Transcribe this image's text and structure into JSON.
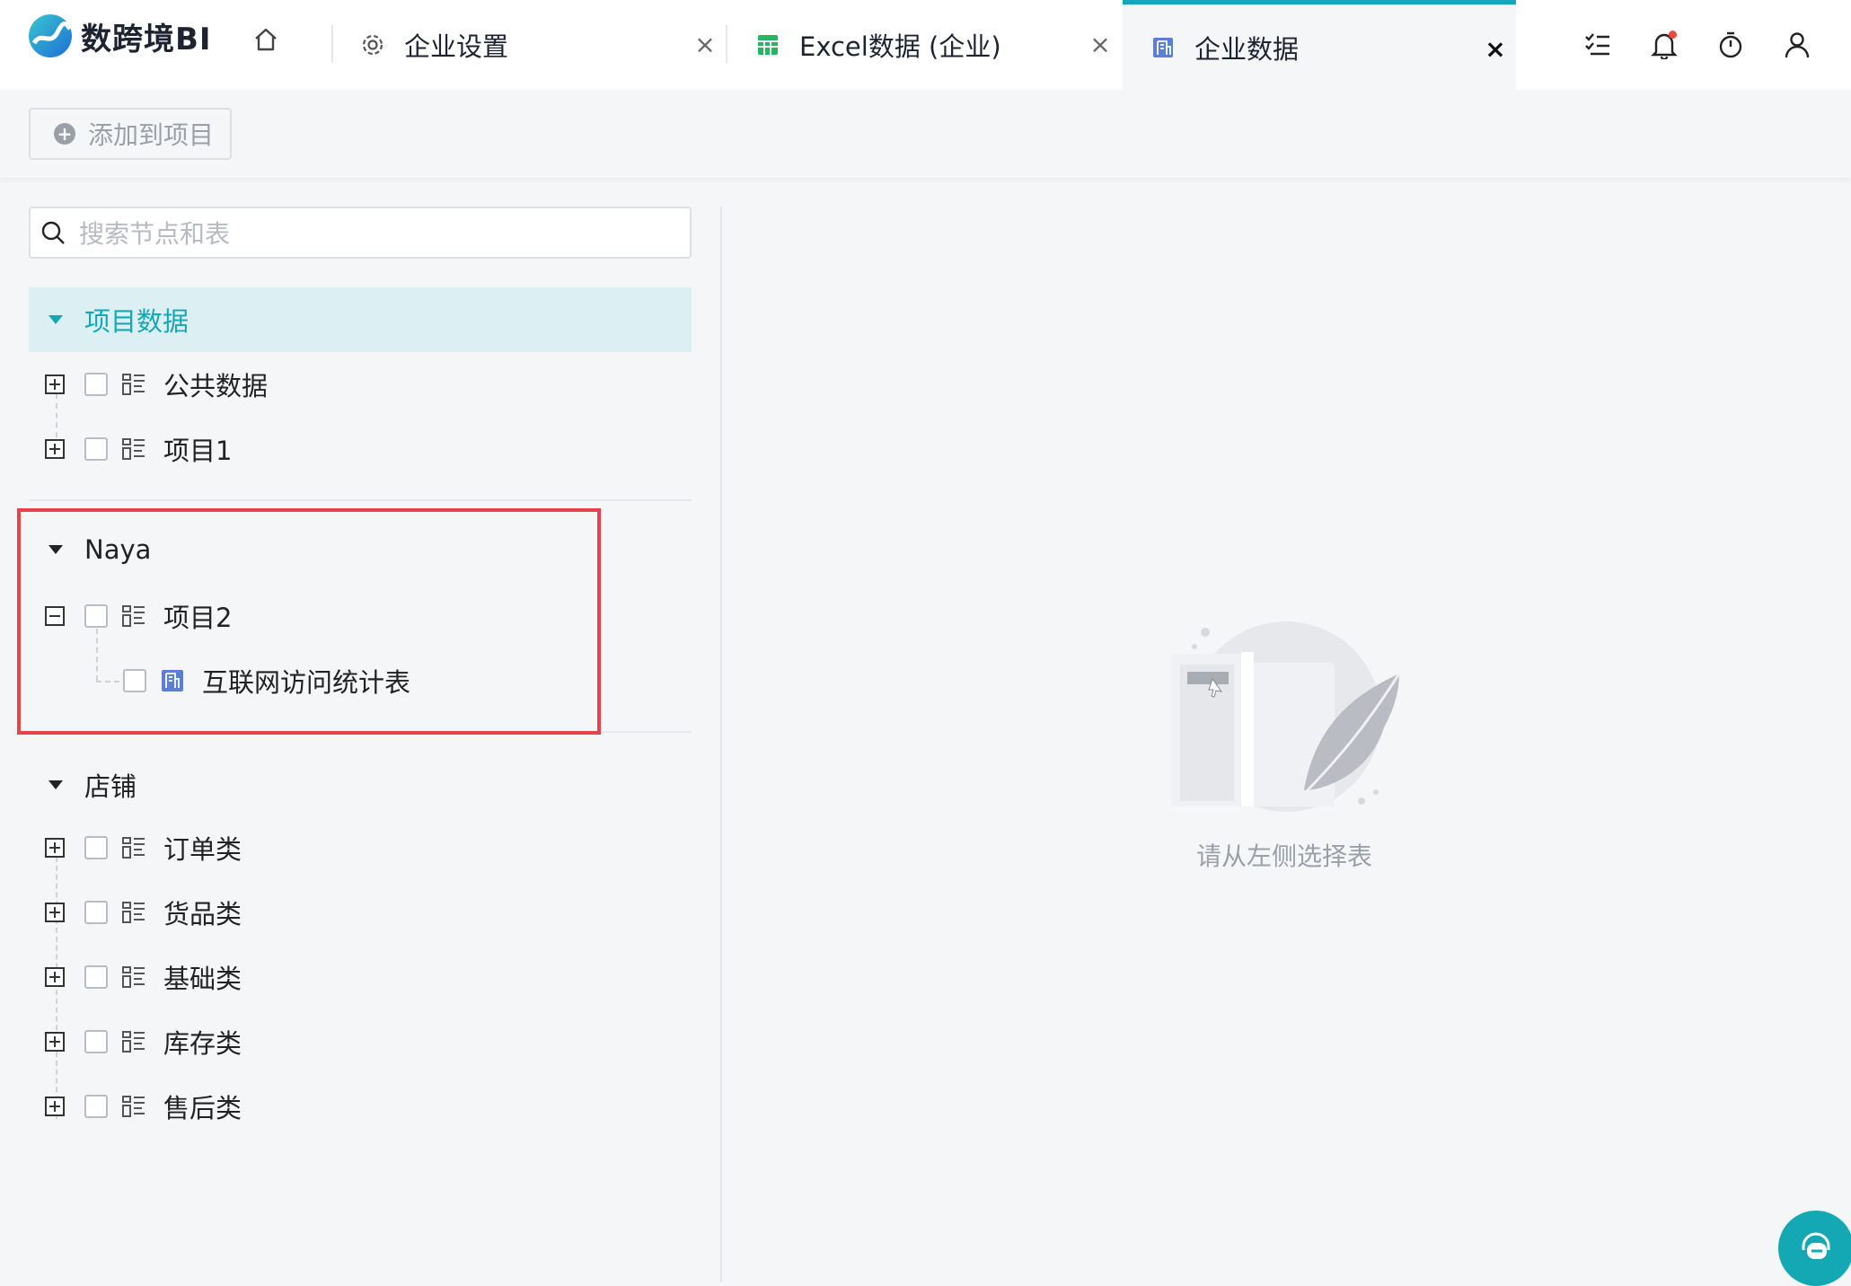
{
  "app": {
    "name": "数跨境BI"
  },
  "tabs": [
    {
      "label": "企业设置",
      "icon": "gear-icon"
    },
    {
      "label": "Excel数据 (企业)",
      "icon": "spreadsheet-icon"
    },
    {
      "label": "企业数据",
      "icon": "building-icon",
      "active": true
    }
  ],
  "toolbar": {
    "add_label": "添加到项目"
  },
  "search": {
    "placeholder": "搜索节点和表"
  },
  "groups": {
    "project_data": {
      "title": "项目数据",
      "items": [
        "公共数据",
        "项目1"
      ]
    },
    "naya": {
      "title": "Naya",
      "project": "项目2",
      "table": "互联网访问统计表"
    },
    "store": {
      "title": "店铺",
      "items": [
        "订单类",
        "货品类",
        "基础类",
        "库存类",
        "售后类"
      ]
    }
  },
  "empty_state": {
    "message": "请从左侧选择表"
  },
  "colors": {
    "accent": "#14a7b4",
    "highlight": "#e8434a"
  }
}
